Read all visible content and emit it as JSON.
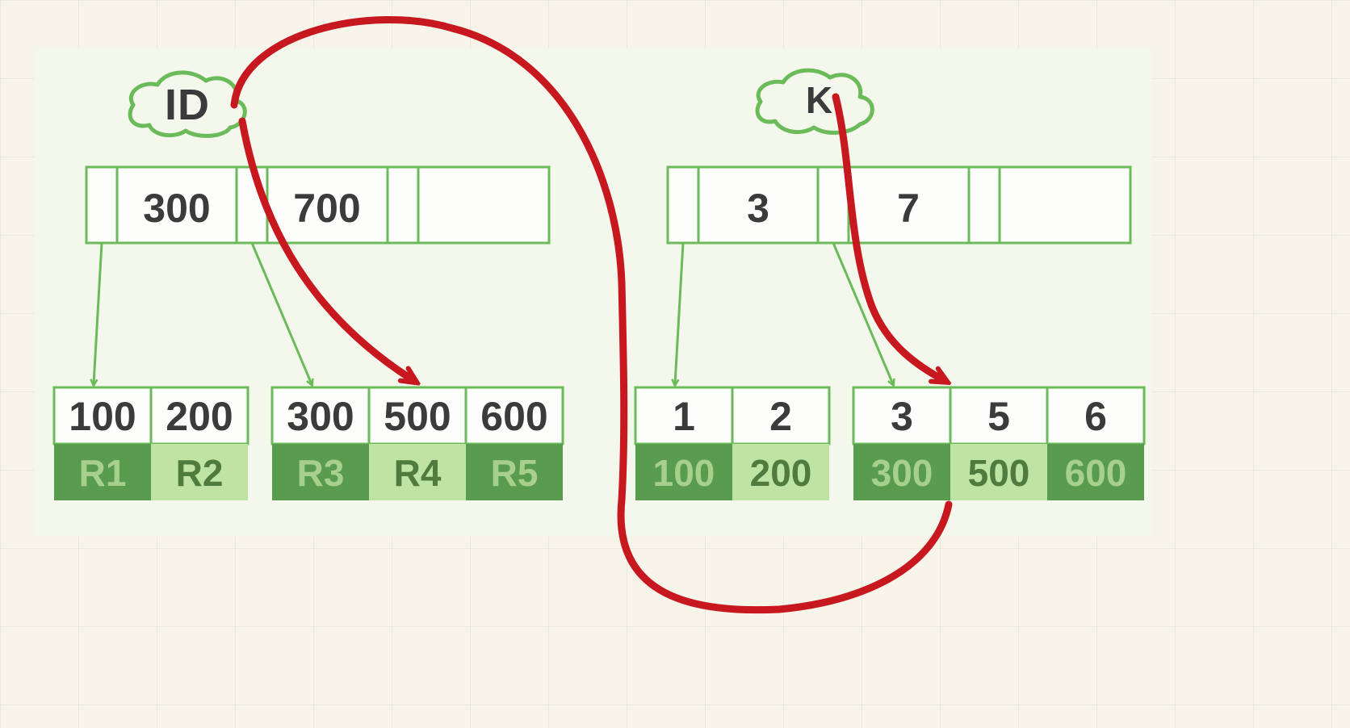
{
  "left": {
    "label": "ID",
    "root_keys": [
      "300",
      "700"
    ],
    "leaf1": {
      "keys": [
        "100",
        "200"
      ],
      "vals": [
        "R1",
        "R2"
      ]
    },
    "leaf2": {
      "keys": [
        "300",
        "500",
        "600"
      ],
      "vals": [
        "R3",
        "R4",
        "R5"
      ]
    }
  },
  "right": {
    "label": "K",
    "root_keys": [
      "3",
      "7"
    ],
    "leaf1": {
      "keys": [
        "1",
        "2"
      ],
      "vals": [
        "100",
        "200"
      ]
    },
    "leaf2": {
      "keys": [
        "3",
        "5",
        "6"
      ],
      "vals": [
        "300",
        "500",
        "600"
      ]
    }
  },
  "colors": {
    "green_stroke": "#6cbb5a",
    "light_green": "#bee3a3",
    "dark_green": "#5a9c4e",
    "red": "#c8181f",
    "text": "#3b3b3b"
  }
}
